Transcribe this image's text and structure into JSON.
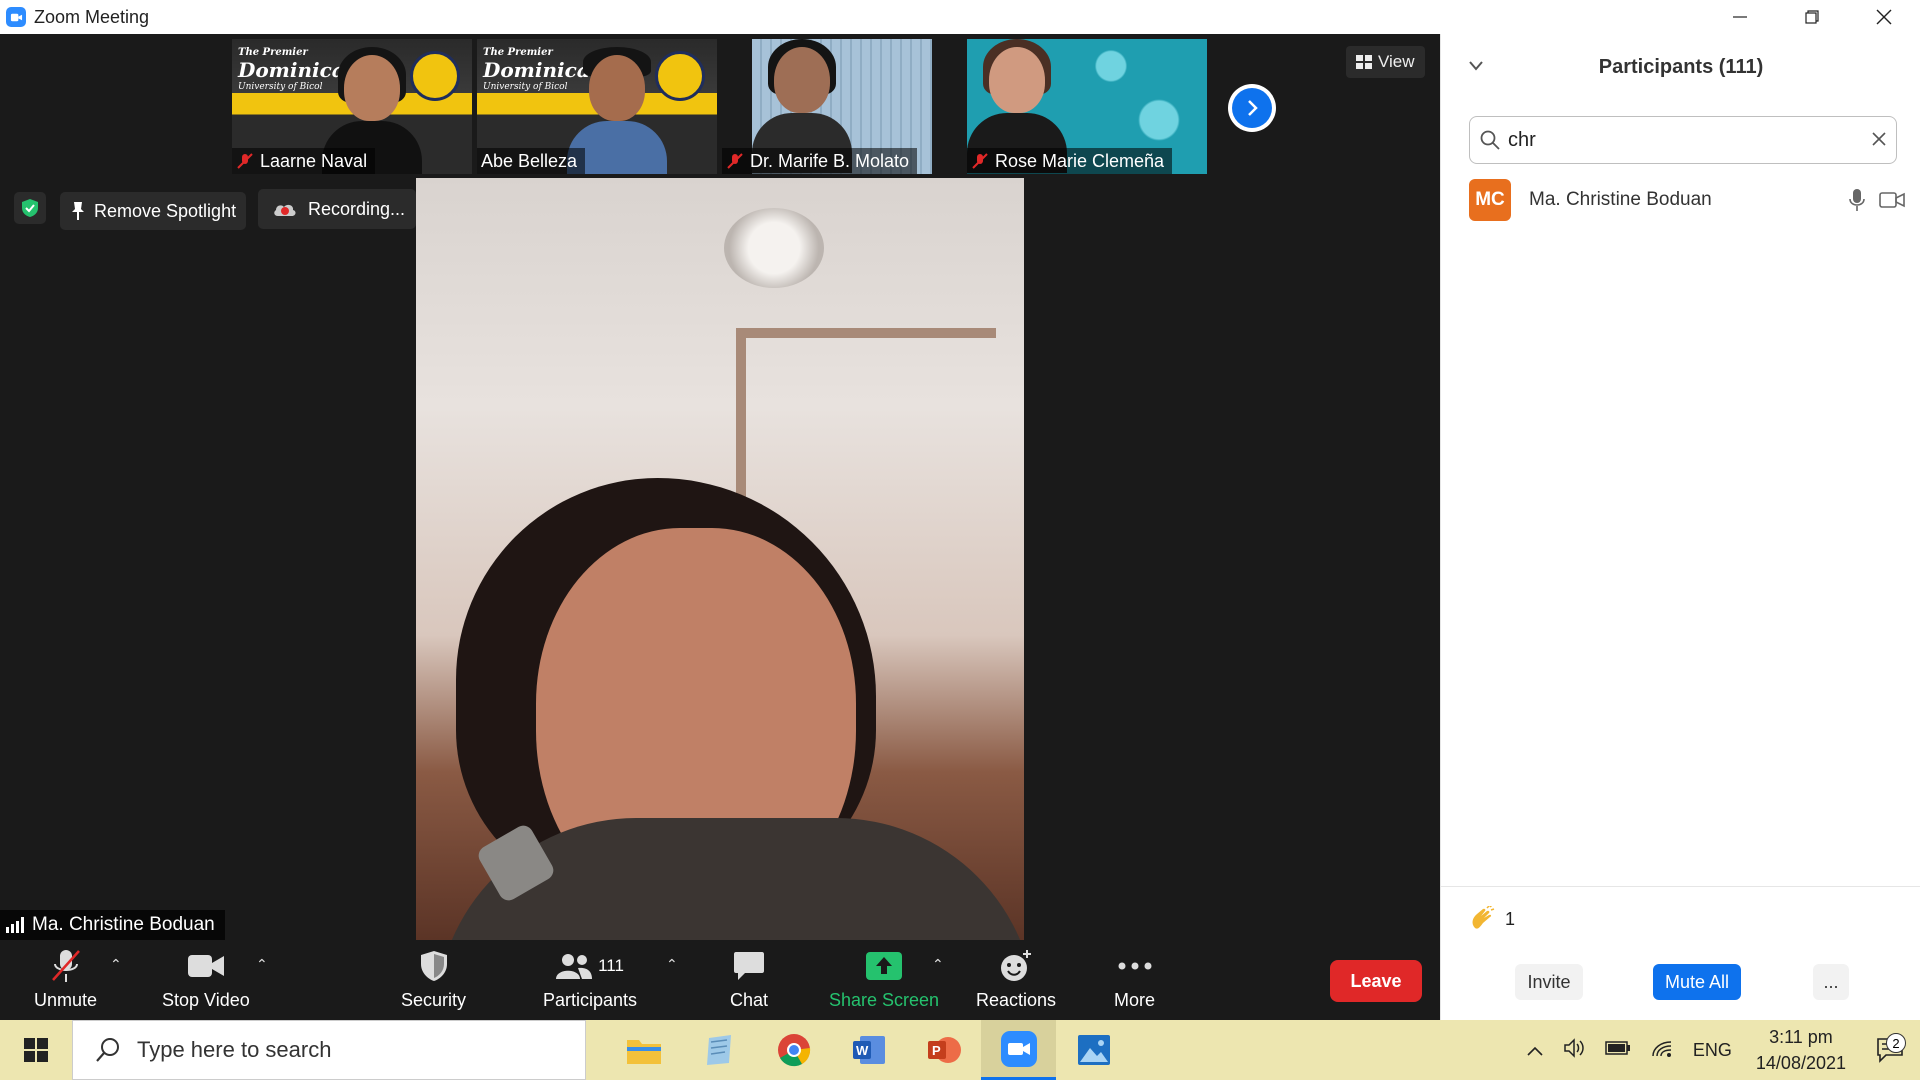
{
  "window": {
    "title": "Zoom Meeting",
    "icon": "zoom-camera-icon"
  },
  "thumbnails": [
    {
      "name": "Laarne Naval",
      "muted": true,
      "background": "dominican",
      "logo_lines": [
        "The Premier",
        "Dominican",
        "University of Bicol"
      ]
    },
    {
      "name": "Abe Belleza",
      "muted": false,
      "background": "dominican",
      "logo_lines": [
        "The Premier",
        "Dominican",
        "University of Bicol"
      ]
    },
    {
      "name": "Dr. Marife B. Molato",
      "muted": true,
      "background": "blinds"
    },
    {
      "name": "Rose Marie Clemeña",
      "muted": true,
      "background": "teal-clouds"
    }
  ],
  "view_button": {
    "label": "View"
  },
  "spotlight": {
    "label": "Remove Spotlight"
  },
  "recording": {
    "label": "Recording..."
  },
  "active_speaker": {
    "name": "Ma. Christine Boduan"
  },
  "toolbar": {
    "unmute": "Unmute",
    "stop_video": "Stop Video",
    "security": "Security",
    "participants": "Participants",
    "participants_count": "111",
    "chat": "Chat",
    "share_screen": "Share Screen",
    "reactions": "Reactions",
    "more": "More",
    "leave": "Leave"
  },
  "panel": {
    "header": "Participants (111)",
    "search_value": "chr",
    "participant": {
      "initials": "MC",
      "name": "Ma. Christine Boduan",
      "avatar_color": "#e86f1e"
    },
    "reaction_count": "1",
    "invite": "Invite",
    "mute_all": "Mute All",
    "more": "..."
  },
  "taskbar": {
    "search_placeholder": "Type here to search",
    "apps": [
      "file-explorer-icon",
      "notepad-icon",
      "chrome-icon",
      "word-icon",
      "powerpoint-icon",
      "zoom-icon",
      "photos-icon"
    ],
    "language": "ENG",
    "time": "3:11 pm",
    "date": "14/08/2021",
    "notifications": "2"
  },
  "colors": {
    "zoom_blue": "#0e72ed",
    "leave_red": "#e02828",
    "share_green": "#25c26e",
    "taskbar": "#ede6b0"
  }
}
